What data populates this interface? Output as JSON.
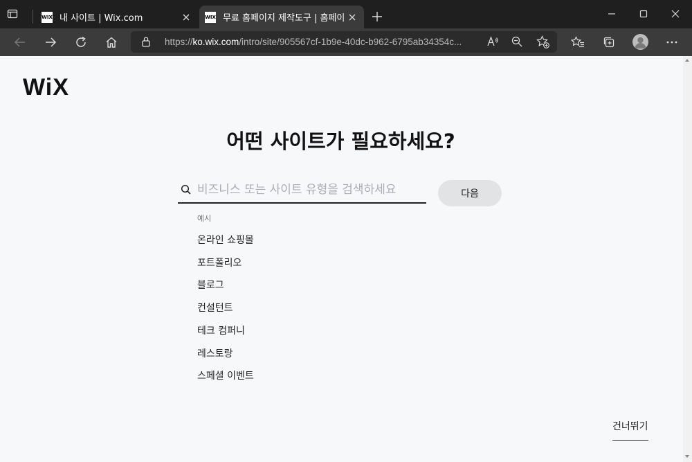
{
  "tabs": [
    {
      "favicon": "WIX",
      "title": "내 사이트 | Wix.com"
    },
    {
      "favicon": "WIX",
      "title": "무료 홈페이지 제작도구 | 홈페이지 만들기"
    }
  ],
  "addressbar": {
    "url_prefix": "https://",
    "url_host": "ko.wix.com",
    "url_path": "/intro/site/905567cf-1b9e-40dc-b962-6795ab34354c..."
  },
  "page": {
    "logo": "WiX",
    "heading": "어떤 사이트가 필요하세요?",
    "search_placeholder": "비즈니스 또는 사이트 유형을 검색하세요",
    "next_label": "다음",
    "examples_label": "예시",
    "examples": [
      "온라인 쇼핑몰",
      "포트폴리오",
      "블로그",
      "컨설턴트",
      "테크 컴퍼니",
      "레스토랑",
      "스페셜 이벤트"
    ],
    "skip_label": "건너뛰기"
  },
  "icons": {
    "tab_actions": "tab-actions-icon",
    "close": "close-icon",
    "new_tab": "plus-icon",
    "back": "back-arrow-icon",
    "forward": "forward-arrow-icon",
    "refresh": "refresh-icon",
    "home": "home-icon",
    "lock": "lock-icon",
    "read_aloud": "read-aloud-icon",
    "zoom": "zoom-out-icon",
    "add_favorite": "add-favorite-icon",
    "favorites": "favorites-icon",
    "collections": "collections-icon",
    "profile": "profile-icon",
    "more": "more-icon",
    "search": "search-icon"
  }
}
